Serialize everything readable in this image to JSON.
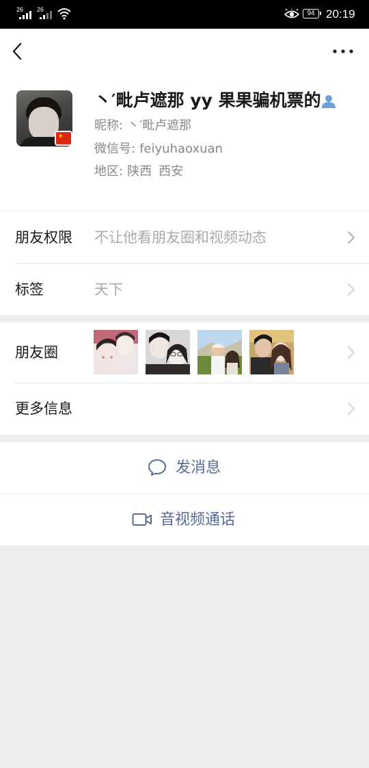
{
  "status_bar": {
    "signal1": "26",
    "signal2": "26",
    "battery": "94",
    "time": "20:19",
    "icons": [
      "signal-icon",
      "signal-icon",
      "wifi-icon",
      "eye-comfort-icon",
      "battery-icon"
    ]
  },
  "nav": {
    "back_icon": "chevron-left-icon",
    "more_icon": "more-dots-icon"
  },
  "profile": {
    "name": "丶′毗卢遮那 yy 果果骗机票的",
    "nickname_label": "昵称:",
    "nickname": "丶′毗卢遮那",
    "wechat_id_label": "微信号:",
    "wechat_id": "feiyuhaoxuan",
    "region_label": "地区:",
    "region_province": "陕西",
    "region_city": "西安",
    "badge_icon": "china-flag-icon",
    "contact_icon": "contact-person-icon"
  },
  "rows": {
    "permissions": {
      "label": "朋友权限",
      "value": "不让他看朋友圈和视频动态"
    },
    "tags": {
      "label": "标签",
      "value": "天下"
    },
    "moments": {
      "label": "朋友圈"
    },
    "more_info": {
      "label": "更多信息"
    }
  },
  "actions": {
    "message": {
      "label": "发消息",
      "icon": "chat-bubble-icon"
    },
    "call": {
      "label": "音视频通话",
      "icon": "video-camera-icon"
    }
  },
  "colors": {
    "link": "#576b95",
    "background": "#ededed",
    "secondary_text": "#888888"
  }
}
